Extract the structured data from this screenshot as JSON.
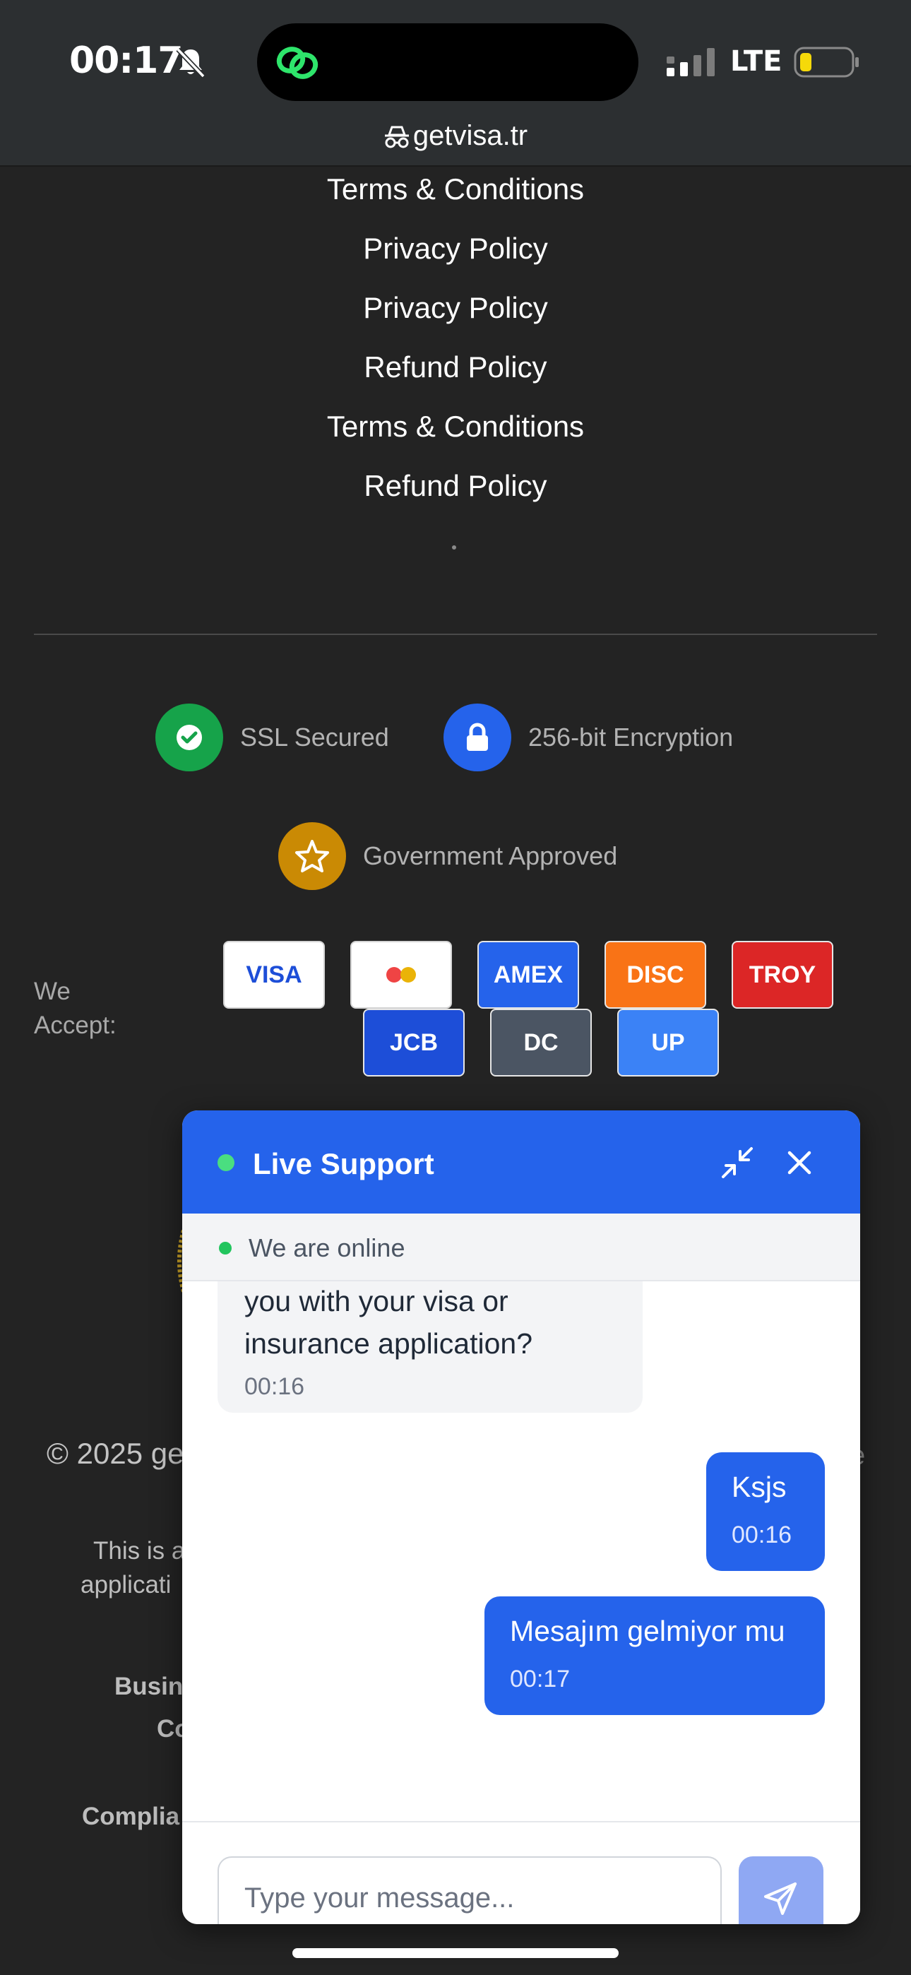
{
  "status_bar": {
    "time": "00:17",
    "network": "LTE",
    "url": "getvisa.tr"
  },
  "footer_links": [
    "Terms & Conditions",
    "Privacy Policy",
    "Privacy Policy",
    "Refund Policy",
    "Terms & Conditions",
    "Refund Policy"
  ],
  "trust_badges": {
    "ssl": "SSL Secured",
    "encryption": "256-bit Encryption",
    "government": "Government Approved"
  },
  "payments": {
    "label": "We Accept:",
    "methods": [
      {
        "name": "VISA",
        "bg": "#ffffff",
        "fg": "#1d4ed8"
      },
      {
        "name": "",
        "bg": "#ffffff",
        "fg": "#000000"
      },
      {
        "name": "AMEX",
        "bg": "#2563eb",
        "fg": "#ffffff"
      },
      {
        "name": "DISC",
        "bg": "#f97316",
        "fg": "#ffffff"
      },
      {
        "name": "TROY",
        "bg": "#dc2626",
        "fg": "#ffffff"
      },
      {
        "name": "JCB",
        "bg": "#1d4ed8",
        "fg": "#ffffff"
      },
      {
        "name": "DC",
        "bg": "#4b5563",
        "fg": "#ffffff"
      },
      {
        "name": "UP",
        "bg": "#3b82f6",
        "fg": "#ffffff"
      }
    ]
  },
  "background_text": {
    "copyright": "© 2025 ge",
    "line1": "This is a",
    "line2": "applicati",
    "business": "Busin",
    "co": "Co",
    "compliance": "Complia"
  },
  "chat": {
    "title": "Live Support",
    "status": "We are online",
    "messages": [
      {
        "from": "agent",
        "text": "you with your visa or insurance application?",
        "time": "00:16"
      },
      {
        "from": "user",
        "text": "Ksjs",
        "time": "00:16"
      },
      {
        "from": "user",
        "text": "Mesajım gelmiyor mu",
        "time": "00:17"
      }
    ],
    "input_placeholder": "Type your message..."
  },
  "colors": {
    "accent": "#2563eb",
    "ssl": "#16a34a",
    "lock": "#2563eb",
    "gov": "#ca8a04"
  }
}
